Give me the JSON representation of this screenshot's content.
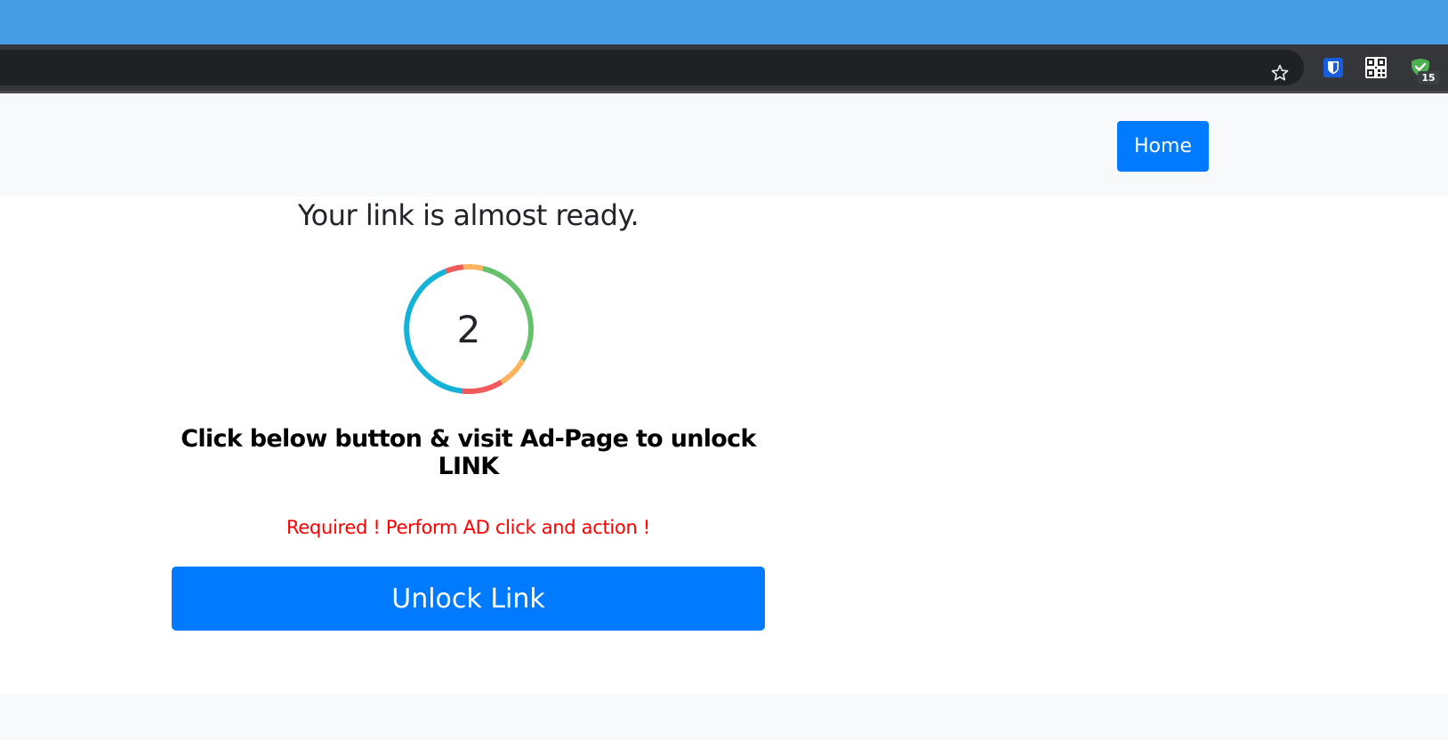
{
  "browser": {
    "extension_badge": "15"
  },
  "nav": {
    "home_label": "Home"
  },
  "main": {
    "title": "Your link is almost ready.",
    "countdown": "2",
    "instruction": "Click below button & visit Ad-Page to unlock LINK",
    "warning": "Required ! Perform AD click and action !",
    "unlock_label": "Unlock Link"
  },
  "icons": {
    "bookmark": "star-icon",
    "extension_1": "bitwarden-shield-icon",
    "extension_2": "qr-code-icon",
    "extension_3": "checkmark-shield-icon"
  },
  "colors": {
    "titlebar": "#479ee5",
    "toolbar": "#35363a",
    "address_bar": "#202124",
    "navbar": "#f8f9fa",
    "primary": "#007bff",
    "warning": "#ff0000",
    "ring_segments": [
      "#13b3d9",
      "#f05a5a",
      "#ffb560",
      "#66c16b"
    ]
  }
}
